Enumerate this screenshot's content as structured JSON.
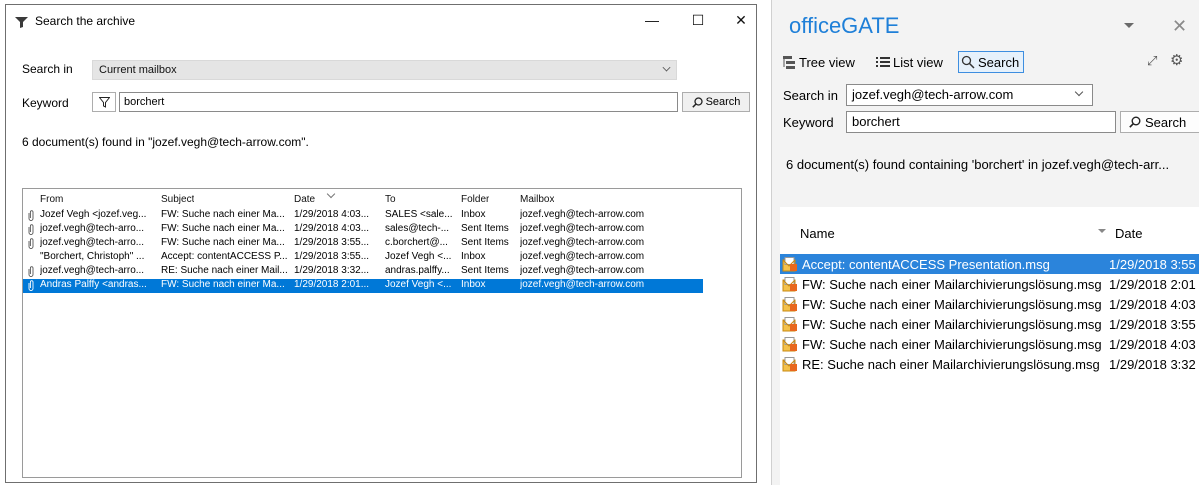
{
  "dialog": {
    "title": "Search the archive",
    "minimize_glyph": "—",
    "maximize_glyph": "☐",
    "close_glyph": "✕",
    "search_in_label": "Search in",
    "search_in_value": "Current mailbox",
    "keyword_label": "Keyword",
    "keyword_value": "borchert",
    "search_button": "Search",
    "result_text": "6 document(s) found in \"jozef.vegh@tech-arrow.com\".",
    "columns": [
      "From",
      "Subject",
      "Date",
      "To",
      "Folder",
      "Mailbox"
    ],
    "rows": [
      {
        "from": "Jozef Vegh <jozef.veg...",
        "subject": "FW: Suche nach einer Ma...",
        "date": "1/29/2018 4:03...",
        "to": "SALES <sale...",
        "folder": "Inbox",
        "mailbox": "jozef.vegh@tech-arrow.com",
        "attach": true,
        "selected": false
      },
      {
        "from": "jozef.vegh@tech-arro...",
        "subject": "FW: Suche nach einer Ma...",
        "date": "1/29/2018 4:03...",
        "to": "sales@tech-...",
        "folder": "Sent Items",
        "mailbox": "jozef.vegh@tech-arrow.com",
        "attach": true,
        "selected": false
      },
      {
        "from": "jozef.vegh@tech-arro...",
        "subject": "FW: Suche nach einer Ma...",
        "date": "1/29/2018 3:55...",
        "to": "c.borchert@...",
        "folder": "Sent Items",
        "mailbox": "jozef.vegh@tech-arrow.com",
        "attach": true,
        "selected": false
      },
      {
        "from": "\"Borchert, Christoph\" ...",
        "subject": "Accept: contentACCESS P...",
        "date": "1/29/2018 3:55...",
        "to": "Jozef Vegh <...",
        "folder": "Inbox",
        "mailbox": "jozef.vegh@tech-arrow.com",
        "attach": false,
        "selected": false
      },
      {
        "from": "jozef.vegh@tech-arro...",
        "subject": "RE: Suche nach einer Mail...",
        "date": "1/29/2018 3:32...",
        "to": "andras.palffy...",
        "folder": "Sent Items",
        "mailbox": "jozef.vegh@tech-arrow.com",
        "attach": true,
        "selected": false
      },
      {
        "from": "Andras Palffy <andras...",
        "subject": "FW: Suche nach einer Ma...",
        "date": "1/29/2018 2:01...",
        "to": "Jozef Vegh <...",
        "folder": "Inbox",
        "mailbox": "jozef.vegh@tech-arrow.com",
        "attach": true,
        "selected": true
      }
    ]
  },
  "panel": {
    "title": "officeGATE",
    "tree_view": "Tree view",
    "list_view": "List view",
    "search_tab": "Search",
    "search_in_label": "Search in",
    "search_in_value": "jozef.vegh@tech-arrow.com",
    "keyword_label": "Keyword",
    "keyword_value": "borchert",
    "search_button": "Search",
    "result_text": "6 document(s) found containing 'borchert' in jozef.vegh@tech-arr...",
    "col_name": "Name",
    "col_date": "Date",
    "rows": [
      {
        "name": "Accept: contentACCESS Presentation.msg",
        "date": "1/29/2018 3:55",
        "selected": true
      },
      {
        "name": "FW: Suche nach einer Mailarchivierungslösung.msg",
        "date": "1/29/2018 2:01",
        "selected": false
      },
      {
        "name": "FW: Suche nach einer Mailarchivierungslösung.msg",
        "date": "1/29/2018 4:03",
        "selected": false
      },
      {
        "name": "FW: Suche nach einer Mailarchivierungslösung.msg",
        "date": "1/29/2018 3:55",
        "selected": false
      },
      {
        "name": "FW: Suche nach einer Mailarchivierungslösung.msg",
        "date": "1/29/2018 4:03",
        "selected": false
      },
      {
        "name": "RE: Suche nach einer Mailarchivierungslösung.msg",
        "date": "1/29/2018 3:32",
        "selected": false
      }
    ],
    "accent_color": "#1e7fd8",
    "selection_color": "#2b84db"
  }
}
